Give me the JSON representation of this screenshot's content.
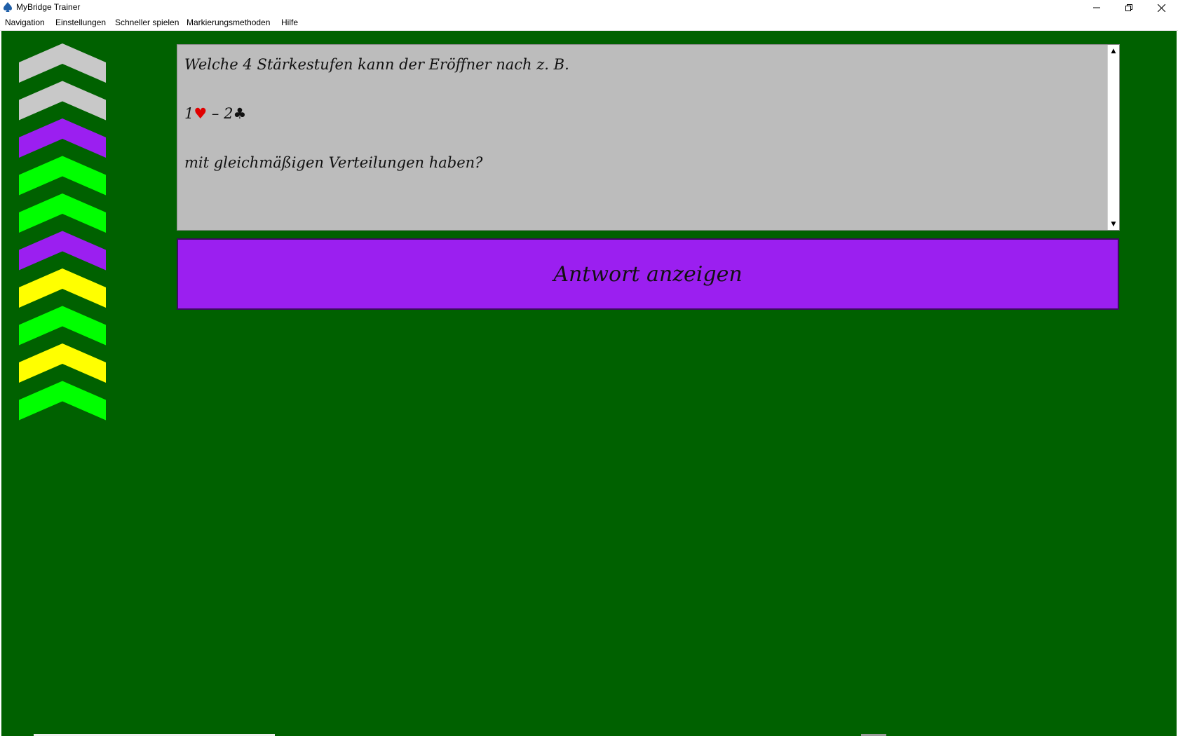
{
  "window": {
    "title": "MyBridge Trainer",
    "icon": "spade-icon",
    "controls": {
      "minimize": "—",
      "maximize": "❐",
      "close": "✕"
    }
  },
  "menu": {
    "items": [
      {
        "label": "Navigation"
      },
      {
        "label": "Einstellungen"
      },
      {
        "label": "Schneller spielen"
      },
      {
        "label": "Markierungsmethoden"
      },
      {
        "label": "Hilfe"
      }
    ]
  },
  "progress": {
    "chevron_colors": [
      "#c8c8c8",
      "#c8c8c8",
      "#9b1ff0",
      "#00ff00",
      "#00ff00",
      "#9b1ff0",
      "#ffff00",
      "#00ff00",
      "#ffff00",
      "#00ff00"
    ]
  },
  "question": {
    "line1": "Welche 4 Stärkestufen kann der Eröffner nach z. B.",
    "bid1_level": "1",
    "bid1_suit": "♥",
    "separator": " – ",
    "bid2_level": "2",
    "bid2_suit": "♣",
    "line3": "mit gleichmäßigen Verteilungen haben?"
  },
  "answer_button": {
    "label": "Antwort anzeigen"
  },
  "colors": {
    "background": "#006100",
    "panel": "#bcbcbc",
    "button": "#9b1ff0",
    "heart": "#e00000"
  }
}
